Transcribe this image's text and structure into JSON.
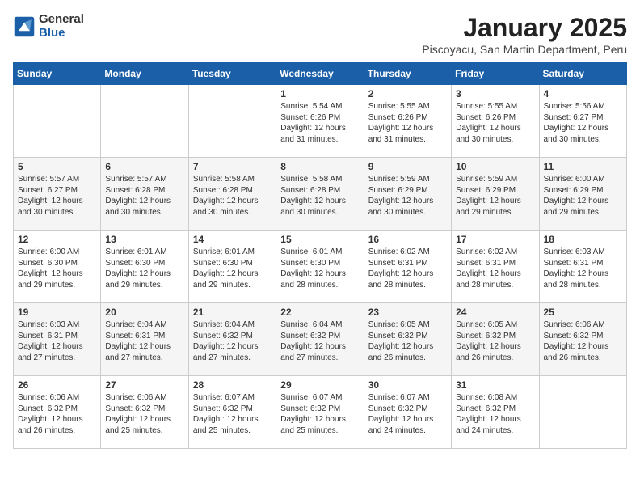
{
  "logo": {
    "general": "General",
    "blue": "Blue"
  },
  "header": {
    "title": "January 2025",
    "location": "Piscoyacu, San Martin Department, Peru"
  },
  "weekdays": [
    "Sunday",
    "Monday",
    "Tuesday",
    "Wednesday",
    "Thursday",
    "Friday",
    "Saturday"
  ],
  "weeks": [
    [
      {
        "day": "",
        "info": ""
      },
      {
        "day": "",
        "info": ""
      },
      {
        "day": "",
        "info": ""
      },
      {
        "day": "1",
        "info": "Sunrise: 5:54 AM\nSunset: 6:26 PM\nDaylight: 12 hours and 31 minutes."
      },
      {
        "day": "2",
        "info": "Sunrise: 5:55 AM\nSunset: 6:26 PM\nDaylight: 12 hours and 31 minutes."
      },
      {
        "day": "3",
        "info": "Sunrise: 5:55 AM\nSunset: 6:26 PM\nDaylight: 12 hours and 30 minutes."
      },
      {
        "day": "4",
        "info": "Sunrise: 5:56 AM\nSunset: 6:27 PM\nDaylight: 12 hours and 30 minutes."
      }
    ],
    [
      {
        "day": "5",
        "info": "Sunrise: 5:57 AM\nSunset: 6:27 PM\nDaylight: 12 hours and 30 minutes."
      },
      {
        "day": "6",
        "info": "Sunrise: 5:57 AM\nSunset: 6:28 PM\nDaylight: 12 hours and 30 minutes."
      },
      {
        "day": "7",
        "info": "Sunrise: 5:58 AM\nSunset: 6:28 PM\nDaylight: 12 hours and 30 minutes."
      },
      {
        "day": "8",
        "info": "Sunrise: 5:58 AM\nSunset: 6:28 PM\nDaylight: 12 hours and 30 minutes."
      },
      {
        "day": "9",
        "info": "Sunrise: 5:59 AM\nSunset: 6:29 PM\nDaylight: 12 hours and 30 minutes."
      },
      {
        "day": "10",
        "info": "Sunrise: 5:59 AM\nSunset: 6:29 PM\nDaylight: 12 hours and 29 minutes."
      },
      {
        "day": "11",
        "info": "Sunrise: 6:00 AM\nSunset: 6:29 PM\nDaylight: 12 hours and 29 minutes."
      }
    ],
    [
      {
        "day": "12",
        "info": "Sunrise: 6:00 AM\nSunset: 6:30 PM\nDaylight: 12 hours and 29 minutes."
      },
      {
        "day": "13",
        "info": "Sunrise: 6:01 AM\nSunset: 6:30 PM\nDaylight: 12 hours and 29 minutes."
      },
      {
        "day": "14",
        "info": "Sunrise: 6:01 AM\nSunset: 6:30 PM\nDaylight: 12 hours and 29 minutes."
      },
      {
        "day": "15",
        "info": "Sunrise: 6:01 AM\nSunset: 6:30 PM\nDaylight: 12 hours and 28 minutes."
      },
      {
        "day": "16",
        "info": "Sunrise: 6:02 AM\nSunset: 6:31 PM\nDaylight: 12 hours and 28 minutes."
      },
      {
        "day": "17",
        "info": "Sunrise: 6:02 AM\nSunset: 6:31 PM\nDaylight: 12 hours and 28 minutes."
      },
      {
        "day": "18",
        "info": "Sunrise: 6:03 AM\nSunset: 6:31 PM\nDaylight: 12 hours and 28 minutes."
      }
    ],
    [
      {
        "day": "19",
        "info": "Sunrise: 6:03 AM\nSunset: 6:31 PM\nDaylight: 12 hours and 27 minutes."
      },
      {
        "day": "20",
        "info": "Sunrise: 6:04 AM\nSunset: 6:31 PM\nDaylight: 12 hours and 27 minutes."
      },
      {
        "day": "21",
        "info": "Sunrise: 6:04 AM\nSunset: 6:32 PM\nDaylight: 12 hours and 27 minutes."
      },
      {
        "day": "22",
        "info": "Sunrise: 6:04 AM\nSunset: 6:32 PM\nDaylight: 12 hours and 27 minutes."
      },
      {
        "day": "23",
        "info": "Sunrise: 6:05 AM\nSunset: 6:32 PM\nDaylight: 12 hours and 26 minutes."
      },
      {
        "day": "24",
        "info": "Sunrise: 6:05 AM\nSunset: 6:32 PM\nDaylight: 12 hours and 26 minutes."
      },
      {
        "day": "25",
        "info": "Sunrise: 6:06 AM\nSunset: 6:32 PM\nDaylight: 12 hours and 26 minutes."
      }
    ],
    [
      {
        "day": "26",
        "info": "Sunrise: 6:06 AM\nSunset: 6:32 PM\nDaylight: 12 hours and 26 minutes."
      },
      {
        "day": "27",
        "info": "Sunrise: 6:06 AM\nSunset: 6:32 PM\nDaylight: 12 hours and 25 minutes."
      },
      {
        "day": "28",
        "info": "Sunrise: 6:07 AM\nSunset: 6:32 PM\nDaylight: 12 hours and 25 minutes."
      },
      {
        "day": "29",
        "info": "Sunrise: 6:07 AM\nSunset: 6:32 PM\nDaylight: 12 hours and 25 minutes."
      },
      {
        "day": "30",
        "info": "Sunrise: 6:07 AM\nSunset: 6:32 PM\nDaylight: 12 hours and 24 minutes."
      },
      {
        "day": "31",
        "info": "Sunrise: 6:08 AM\nSunset: 6:32 PM\nDaylight: 12 hours and 24 minutes."
      },
      {
        "day": "",
        "info": ""
      }
    ]
  ]
}
